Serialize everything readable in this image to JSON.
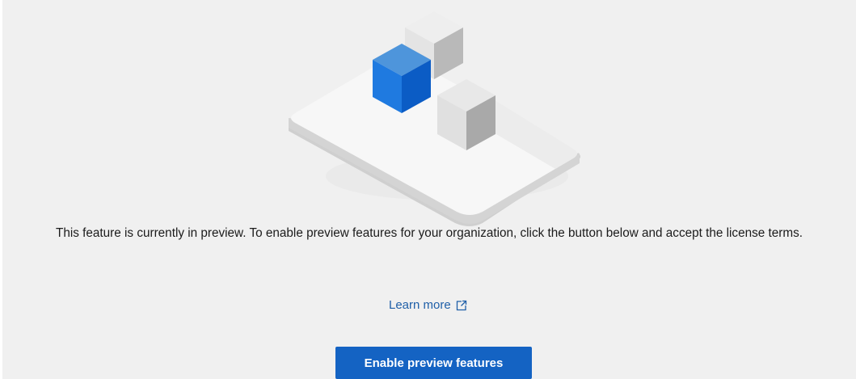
{
  "message": "This feature is currently in preview. To enable preview features for your organization, click the button below and accept the license terms.",
  "learn_more": {
    "label": "Learn more",
    "icon": "external-link-icon"
  },
  "enable_button": {
    "label": "Enable preview features"
  },
  "illustration": {
    "icon": "isometric-cubes-illustration",
    "colors": {
      "blue_cube": "#1e78d8",
      "tray": "#f6f6f6",
      "gray_cube": "#d9d9d9"
    }
  },
  "colors": {
    "background": "#f0f0f0",
    "link": "#1f5fa8",
    "button": "#1463c3",
    "button_text": "#ffffff"
  }
}
